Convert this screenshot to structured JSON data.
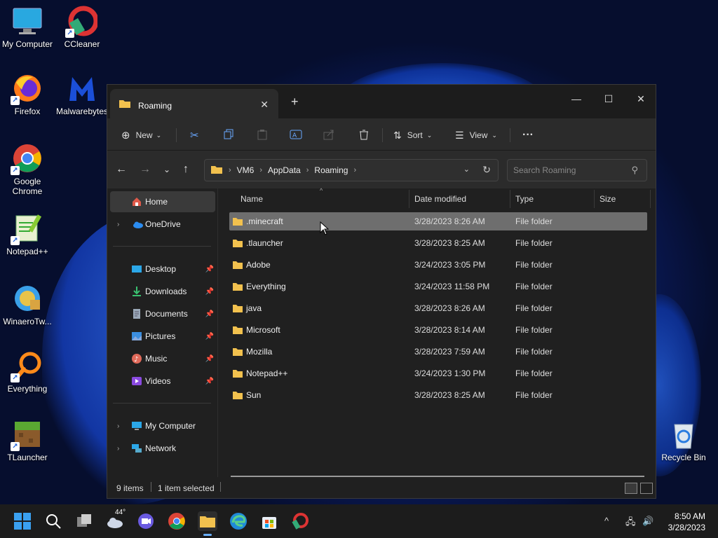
{
  "desktop": {
    "icons": [
      {
        "label": "My Computer"
      },
      {
        "label": "CCleaner"
      },
      {
        "label": "Firefox"
      },
      {
        "label": "Malwarebytes"
      },
      {
        "label": "Google Chrome"
      },
      {
        "label": "Notepad++"
      },
      {
        "label": "WinaeroTw..."
      },
      {
        "label": "Everything"
      },
      {
        "label": "TLauncher"
      },
      {
        "label": "Recycle Bin"
      }
    ]
  },
  "window": {
    "tab_title": "Roaming",
    "toolbar": {
      "new_label": "New",
      "sort_label": "Sort",
      "view_label": "View",
      "more_label": "···"
    },
    "breadcrumb": [
      "VM6",
      "AppData",
      "Roaming"
    ],
    "search": {
      "placeholder": "Search Roaming"
    },
    "nav": {
      "home": "Home",
      "onedrive": "OneDrive",
      "quick": [
        {
          "label": "Desktop"
        },
        {
          "label": "Downloads"
        },
        {
          "label": "Documents"
        },
        {
          "label": "Pictures"
        },
        {
          "label": "Music"
        },
        {
          "label": "Videos"
        }
      ],
      "my_computer": "My Computer",
      "network": "Network"
    },
    "columns": {
      "name": "Name",
      "date": "Date modified",
      "type": "Type",
      "size": "Size"
    },
    "files": [
      {
        "name": ".minecraft",
        "date": "3/28/2023 8:26 AM",
        "type": "File folder"
      },
      {
        "name": ".tlauncher",
        "date": "3/28/2023 8:25 AM",
        "type": "File folder"
      },
      {
        "name": "Adobe",
        "date": "3/24/2023 3:05 PM",
        "type": "File folder"
      },
      {
        "name": "Everything",
        "date": "3/24/2023 11:58 PM",
        "type": "File folder"
      },
      {
        "name": "java",
        "date": "3/28/2023 8:26 AM",
        "type": "File folder"
      },
      {
        "name": "Microsoft",
        "date": "3/28/2023 8:14 AM",
        "type": "File folder"
      },
      {
        "name": "Mozilla",
        "date": "3/28/2023 7:59 AM",
        "type": "File folder"
      },
      {
        "name": "Notepad++",
        "date": "3/24/2023 1:30 PM",
        "type": "File folder"
      },
      {
        "name": "Sun",
        "date": "3/28/2023 8:25 AM",
        "type": "File folder"
      }
    ],
    "status": {
      "items": "9 items",
      "selected": "1 item selected"
    }
  },
  "taskbar": {
    "weather_temp": "44°",
    "clock_time": "8:50 AM",
    "clock_date": "3/28/2023"
  },
  "colors": {
    "folder": "#f2c14e",
    "accent": "#0067c0",
    "selected_row": "#6e6e6e"
  }
}
